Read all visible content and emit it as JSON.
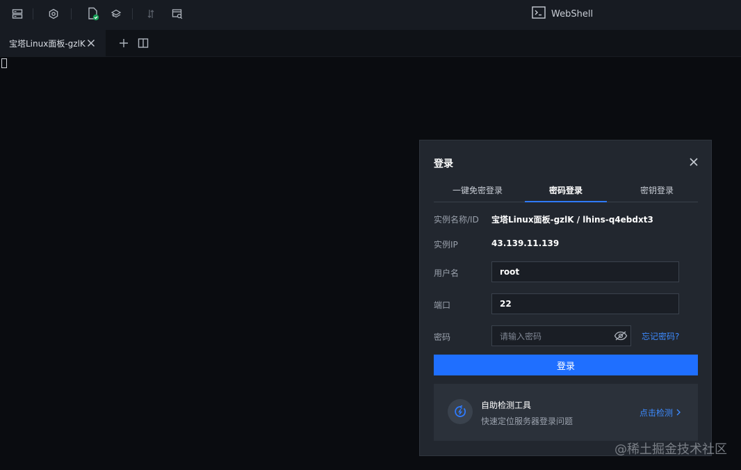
{
  "colors": {
    "accent": "#1f6fff",
    "link": "#3d8bff",
    "dialog_bg": "#22272f",
    "terminal_bg": "#0a0c10"
  },
  "toolbar": {
    "icons": [
      "server-list-icon",
      "settings-icon",
      "file-check-icon",
      "snippet-icon",
      "transfer-icon",
      "monitor-icon"
    ],
    "title": "WebShell"
  },
  "tabbar": {
    "tabs": [
      {
        "label": "宝塔Linux面板-gzlK"
      }
    ]
  },
  "dialog": {
    "title": "登录",
    "tabs": [
      {
        "label": "一键免密登录"
      },
      {
        "label": "密码登录"
      },
      {
        "label": "密钥登录"
      }
    ],
    "active_tab": "密码登录",
    "instance_label": "实例名称/ID",
    "instance_value": "宝塔Linux面板-gzlK / lhins-q4ebdxt3",
    "ip_label": "实例IP",
    "ip_value": "43.139.11.139",
    "username_label": "用户名",
    "username_value": "root",
    "port_label": "端口",
    "port_value": "22",
    "password_label": "密码",
    "password_placeholder": "请输入密码",
    "forgot_label": "忘记密码?",
    "login_button": "登录",
    "tool": {
      "title": "自助检测工具",
      "desc": "快速定位服务器登录问题",
      "link": "点击检测"
    }
  },
  "watermark": "@稀土掘金技术社区"
}
